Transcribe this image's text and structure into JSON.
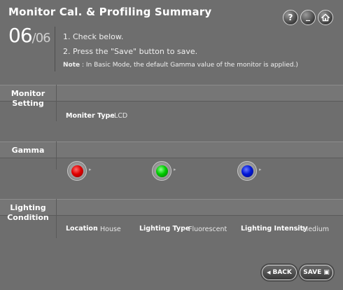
{
  "header": {
    "title": "Monitor Cal. & Profiling Summary",
    "help_icon": "?",
    "minimize_icon": "_",
    "home_icon": "home"
  },
  "step": {
    "current": "06",
    "separator": "/",
    "total": "06"
  },
  "instructions": {
    "line1": "1.  Check below.",
    "line2": "2.  Press the \"Save\" button to save.",
    "note_label": "Note",
    "note_text": " : In Basic Mode, the default Gamma value of the monitor is applied.)"
  },
  "sections": {
    "monitor": {
      "label_line1": "Monitor",
      "label_line2": "Setting",
      "type_label": "Moniter Type",
      "type_value": "LCD"
    },
    "gamma": {
      "label": "Gamma",
      "colors": {
        "red": "#e00000",
        "green": "#00cc00",
        "blue": "#0018d8"
      }
    },
    "lighting": {
      "label_line1": "Lighting",
      "label_line2": "Condition",
      "location_label": "Location",
      "location_value": "House",
      "type_label": "Lighting Type",
      "type_value": "Fluorescent",
      "intensity_label": "Lighting Intensity",
      "intensity_value": "Medium"
    }
  },
  "buttons": {
    "back": "BACK",
    "save": "SAVE"
  },
  "icons": {
    "bullet_arrow": "▸",
    "back_arrow": "◀",
    "save_icon": "▣"
  }
}
